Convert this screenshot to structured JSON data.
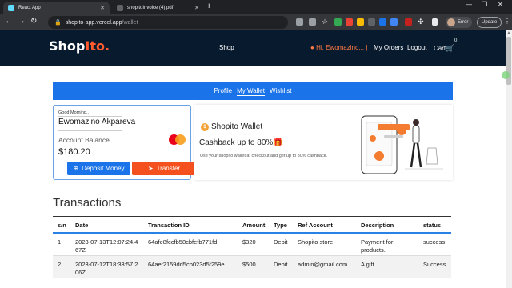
{
  "browser": {
    "tabs": [
      {
        "title": "React App",
        "favicon_color": "#61dafb"
      },
      {
        "title": "shopitoInvoice (4).pdf",
        "favicon_color": "#5f6368"
      }
    ],
    "url_host": "shopito-app.vercel.app",
    "url_path": "/wallet",
    "profile_label": "Error",
    "update_label": "Update"
  },
  "site": {
    "logo_main": "Shop",
    "logo_accent": "Ito.",
    "nav": {
      "shop": "Shop",
      "greeting": "Hi, Ewomazino... |",
      "orders": "My Orders",
      "logout": "Logout",
      "cart": "Cart",
      "cart_count": "0"
    }
  },
  "wallet_nav": {
    "profile": "Profile",
    "wallet": "My Wallet",
    "wishlist": "Wishlist"
  },
  "card": {
    "greeting": "Good Morning..",
    "name": "Ewomazino Akpareva",
    "balance_label": "Account Balance",
    "balance": "$180.20",
    "deposit_label": "Deposit Money",
    "transfer_label": "Transfer"
  },
  "promo": {
    "title": "Shopito Wallet",
    "subtitle": "Cashback up to 80%",
    "description": "Use your shopito wallet at checkout and get up to 80% cashback."
  },
  "transactions": {
    "title": "Transactions",
    "headers": [
      "s/n",
      "Date",
      "Transaction ID",
      "Amount",
      "Type",
      "Ref Account",
      "Description",
      "status"
    ],
    "rows": [
      [
        "1",
        "2023-07-13T12:07:24.467Z",
        "64afe8fccfb58cbfefb771fd",
        "$320",
        "Debit",
        "Shopito store",
        "Payment for products.",
        "success"
      ],
      [
        "2",
        "2023-07-12T18:33:57.206Z",
        "64aef2159dd5cb023d5f259e",
        "$500",
        "Debit",
        "admin@gmail.com",
        "A gift..",
        "Success"
      ]
    ]
  },
  "colors": {
    "header_bg": "#081a2d",
    "accent_orange": "#ff5b2e",
    "primary_blue": "#1a73e8",
    "transfer_orange": "#f4511e"
  }
}
